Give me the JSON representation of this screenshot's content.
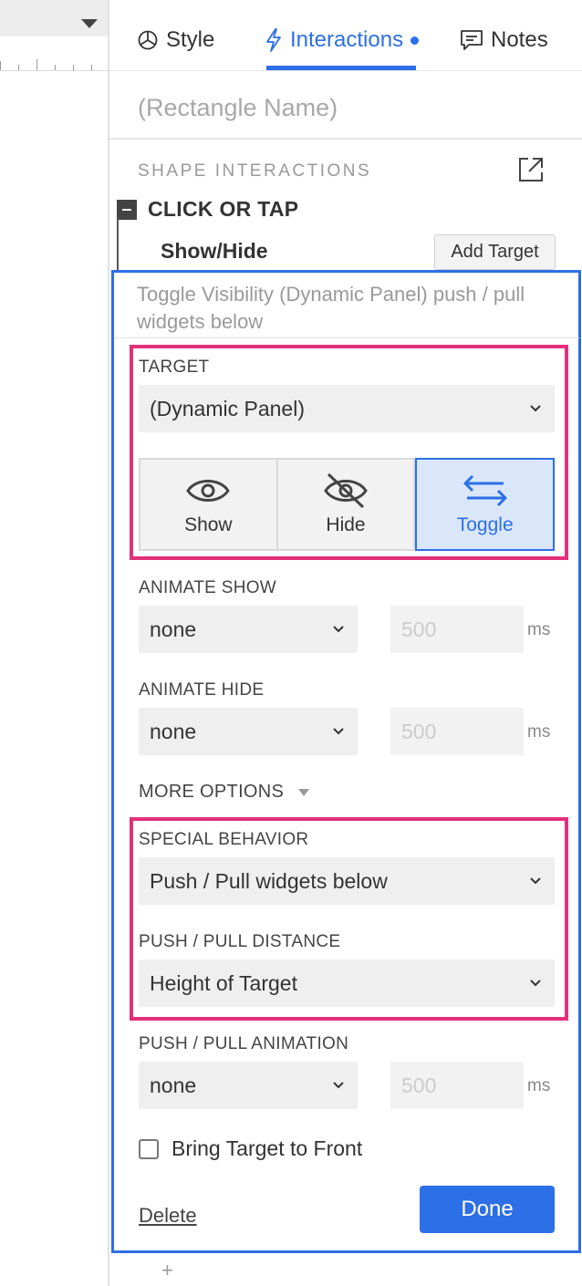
{
  "tabs": {
    "style_label": "Style",
    "interactions_label": "Interactions",
    "notes_label": "Notes"
  },
  "widget_name_placeholder": "(Rectangle Name)",
  "section": {
    "label": "SHAPE INTERACTIONS"
  },
  "event": {
    "label": "CLICK OR TAP",
    "action_label": "Show/Hide",
    "add_target_label": "Add Target"
  },
  "editor": {
    "summary": "Toggle Visibility (Dynamic Panel)  push / pull widgets below",
    "target_label": "TARGET",
    "target_value": "(Dynamic Panel)",
    "visibility_options": [
      {
        "label": "Show",
        "icon": "eye-icon",
        "selected": false
      },
      {
        "label": "Hide",
        "icon": "eye-off-icon",
        "selected": false
      },
      {
        "label": "Toggle",
        "icon": "swap-arrows-icon",
        "selected": true
      }
    ],
    "animate_show_label": "ANIMATE SHOW",
    "animate_show_value": "none",
    "animate_show_duration": "500",
    "animate_hide_label": "ANIMATE HIDE",
    "animate_hide_value": "none",
    "animate_hide_duration": "500",
    "ms_unit": "ms",
    "more_options_label": "MORE OPTIONS",
    "special_behavior_label": "SPECIAL BEHAVIOR",
    "special_behavior_value": "Push / Pull widgets below",
    "push_pull_distance_label": "PUSH / PULL DISTANCE",
    "push_pull_distance_value": "Height of Target",
    "push_pull_animation_label": "PUSH / PULL ANIMATION",
    "push_pull_animation_value": "none",
    "push_pull_animation_duration": "500",
    "bring_to_front_label": "Bring Target to Front",
    "bring_to_front_checked": false,
    "delete_label": "Delete",
    "done_label": "Done"
  },
  "plus_glyph": "+",
  "colors": {
    "accent": "#2c6fe6",
    "highlight": "#e2307a"
  }
}
